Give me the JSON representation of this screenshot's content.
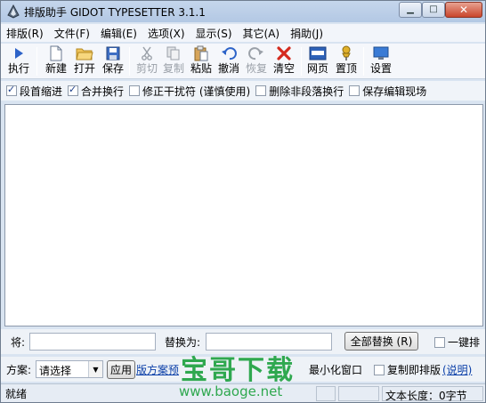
{
  "window": {
    "title": "排版助手 GIDOT TYPESETTER 3.1.1"
  },
  "menu": [
    "排版(R)",
    "文件(F)",
    "编辑(E)",
    "选项(X)",
    "显示(S)",
    "其它(A)",
    "捐助(J)"
  ],
  "toolbar": {
    "run": "执行",
    "new": "新建",
    "open": "打开",
    "save": "保存",
    "cut": "剪切",
    "copy": "复制",
    "paste": "粘贴",
    "undo": "撤消",
    "redo": "恢复",
    "clear": "清空",
    "web": "网页",
    "top": "置顶",
    "settings": "设置"
  },
  "options": [
    {
      "label": "段首缩进",
      "checked": true
    },
    {
      "label": "合并换行",
      "checked": true
    },
    {
      "label": "修正干扰符 (谨慎使用)",
      "checked": false
    },
    {
      "label": "删除非段落换行",
      "checked": false
    },
    {
      "label": "保存编辑现场",
      "checked": false
    }
  ],
  "replace": {
    "find_label": "将:",
    "find_value": "",
    "replace_label": "替换为:",
    "replace_value": "",
    "replace_all_button": "全部替换 (R)",
    "one_key_label": "一键排"
  },
  "scheme": {
    "label": "方案:",
    "selected": "请选择",
    "apply_button": "应用",
    "link_text": "版方案预",
    "minimize_label": "最小化窗口",
    "copy_label": "复制即排版",
    "help_text": "(说明)"
  },
  "status": {
    "ready": "就绪",
    "length": "文本长度：0字节"
  },
  "watermark": {
    "title": "宝哥下载",
    "url": "www.baoge.net"
  },
  "colors": {
    "accent": "#1d3f8a",
    "watermark": "#2fa84f",
    "close": "#c9452c"
  }
}
